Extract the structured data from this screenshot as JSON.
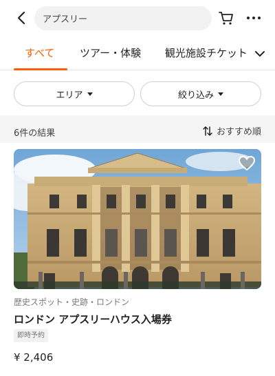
{
  "search": {
    "placeholder": "アプスリー"
  },
  "tabs": [
    {
      "label": "すべて"
    },
    {
      "label": "ツアー・体験"
    },
    {
      "label": "観光施設チケット"
    }
  ],
  "filters": {
    "area_label": "エリア",
    "narrow_label": "絞り込み"
  },
  "results": {
    "count_text": "6件の結果",
    "sort_label": "おすすめ順"
  },
  "product": {
    "category": "歴史スポット・史跡・ロンドン",
    "title": "ロンドン アプスリーハウス入場券",
    "badge": "即時予約",
    "price": "¥ 2,406",
    "image_desc_icon": "photo"
  },
  "colors": {
    "accent": "#ff5b00",
    "text": "#222222",
    "muted": "#777777",
    "background_gray": "#f5f5f5"
  },
  "icons": {
    "back": "chevron-left-icon",
    "cart": "cart-icon",
    "more": "more-icon",
    "tabs_expand": "chevron-down-icon",
    "sort": "sort-icon",
    "favorite": "heart-icon"
  }
}
